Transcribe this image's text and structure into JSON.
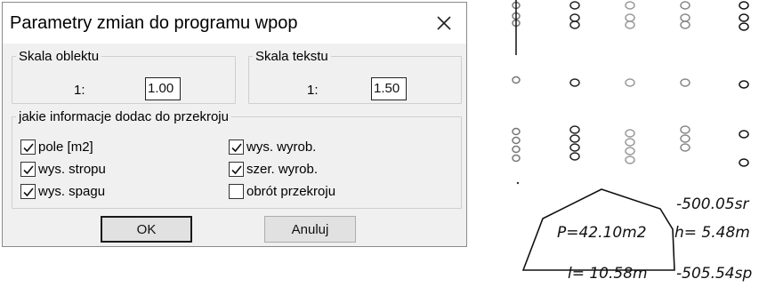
{
  "dialog": {
    "title": "Parametry zmian do programu wpop",
    "scale_object": {
      "legend": "Skala oblektu",
      "prefix": "1:",
      "value": "1.00"
    },
    "scale_text": {
      "legend": "Skala tekstu",
      "prefix": "1:",
      "value": "1.50"
    },
    "info_group": {
      "legend": "jakie informacje dodac do przekroju",
      "options": [
        {
          "label": "pole [m2]",
          "checked": true
        },
        {
          "label": "wys. wyrob.",
          "checked": true
        },
        {
          "label": "wys. stropu",
          "checked": true
        },
        {
          "label": "szer. wyrob.",
          "checked": true
        },
        {
          "label": "wys. spagu",
          "checked": true
        },
        {
          "label": "obrót przekroju",
          "checked": false
        }
      ]
    },
    "buttons": {
      "ok": "OK",
      "cancel": "Anuluj"
    }
  },
  "drawing": {
    "top_level": "-500.05sr",
    "area": "P=42.10m2",
    "height": "h= 5.48m",
    "width": "l= 10.58m",
    "bottom_level": "-505.54sp"
  }
}
